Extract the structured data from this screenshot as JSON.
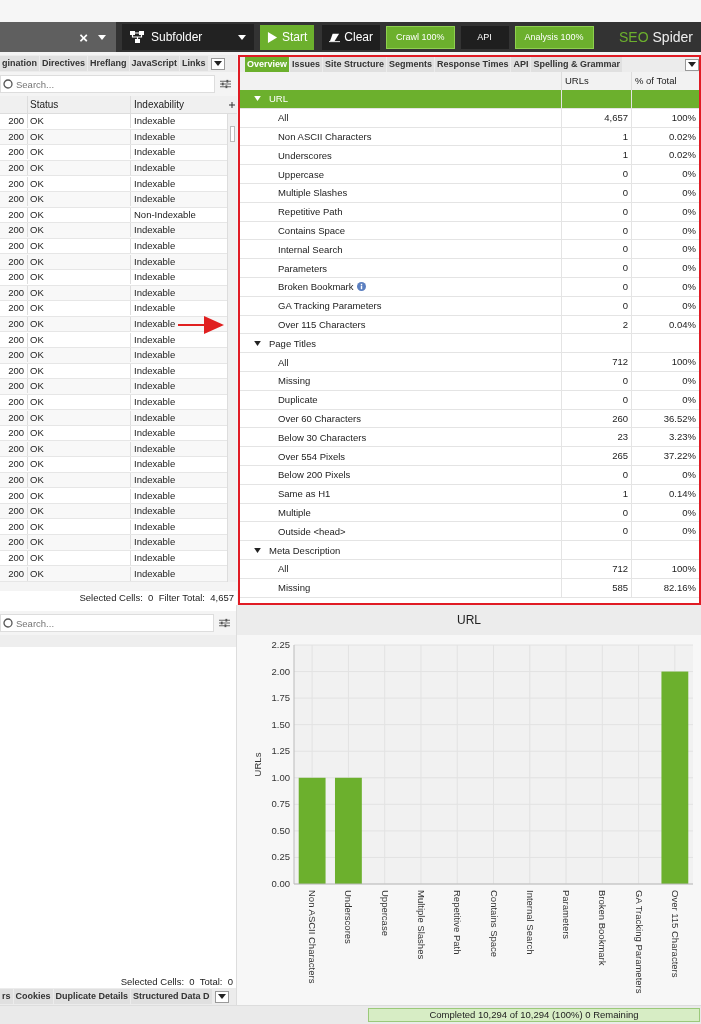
{
  "toolbar": {
    "url_field": {
      "clear_glyph": "×"
    },
    "mode": "Subfolder",
    "buttons": [
      {
        "label": "Start",
        "kind": "start"
      },
      {
        "label": "Clear",
        "kind": "clear"
      }
    ],
    "badges": [
      {
        "label": "Crawl 100%",
        "on": true
      },
      {
        "label": "API",
        "on": false
      },
      {
        "label": "Analysis 100%",
        "on": true
      }
    ],
    "logo": {
      "brand": "SEO",
      "product": "Spider"
    }
  },
  "left_tabs": [
    {
      "label": "gination",
      "selected": false
    },
    {
      "label": "Directives",
      "selected": false
    },
    {
      "label": "Hreflang",
      "selected": false
    },
    {
      "label": "JavaScript",
      "selected": false
    },
    {
      "label": "Links",
      "selected": false
    }
  ],
  "left_search": {
    "placeholder": "Search..."
  },
  "left_table": {
    "columns": [
      "Status",
      "Indexability"
    ],
    "rows": [
      {
        "code": "200",
        "status": "OK",
        "indexability": "Indexable"
      },
      {
        "code": "200",
        "status": "OK",
        "indexability": "Indexable"
      },
      {
        "code": "200",
        "status": "OK",
        "indexability": "Indexable"
      },
      {
        "code": "200",
        "status": "OK",
        "indexability": "Indexable"
      },
      {
        "code": "200",
        "status": "OK",
        "indexability": "Indexable"
      },
      {
        "code": "200",
        "status": "OK",
        "indexability": "Indexable"
      },
      {
        "code": "200",
        "status": "OK",
        "indexability": "Non-Indexable"
      },
      {
        "code": "200",
        "status": "OK",
        "indexability": "Indexable"
      },
      {
        "code": "200",
        "status": "OK",
        "indexability": "Indexable"
      },
      {
        "code": "200",
        "status": "OK",
        "indexability": "Indexable"
      },
      {
        "code": "200",
        "status": "OK",
        "indexability": "Indexable"
      },
      {
        "code": "200",
        "status": "OK",
        "indexability": "Indexable"
      },
      {
        "code": "200",
        "status": "OK",
        "indexability": "Indexable"
      },
      {
        "code": "200",
        "status": "OK",
        "indexability": "Indexable"
      },
      {
        "code": "200",
        "status": "OK",
        "indexability": "Indexable"
      },
      {
        "code": "200",
        "status": "OK",
        "indexability": "Indexable"
      },
      {
        "code": "200",
        "status": "OK",
        "indexability": "Indexable"
      },
      {
        "code": "200",
        "status": "OK",
        "indexability": "Indexable"
      },
      {
        "code": "200",
        "status": "OK",
        "indexability": "Indexable"
      },
      {
        "code": "200",
        "status": "OK",
        "indexability": "Indexable"
      },
      {
        "code": "200",
        "status": "OK",
        "indexability": "Indexable"
      },
      {
        "code": "200",
        "status": "OK",
        "indexability": "Indexable"
      },
      {
        "code": "200",
        "status": "OK",
        "indexability": "Indexable"
      },
      {
        "code": "200",
        "status": "OK",
        "indexability": "Indexable"
      },
      {
        "code": "200",
        "status": "OK",
        "indexability": "Indexable"
      },
      {
        "code": "200",
        "status": "OK",
        "indexability": "Indexable"
      },
      {
        "code": "200",
        "status": "OK",
        "indexability": "Indexable"
      },
      {
        "code": "200",
        "status": "OK",
        "indexability": "Indexable"
      },
      {
        "code": "200",
        "status": "OK",
        "indexability": "Indexable"
      },
      {
        "code": "200",
        "status": "OK",
        "indexability": "Indexable"
      }
    ],
    "footer": "Selected Cells:  0  Filter Total:  4,657"
  },
  "right_tabs": [
    {
      "label": "Overview",
      "selected": true
    },
    {
      "label": "Issues",
      "selected": false
    },
    {
      "label": "Site Structure",
      "selected": false
    },
    {
      "label": "Segments",
      "selected": false
    },
    {
      "label": "Response Times",
      "selected": false
    },
    {
      "label": "API",
      "selected": false
    },
    {
      "label": "Spelling & Grammar",
      "selected": false
    }
  ],
  "overview": {
    "highlighted": true,
    "columns": [
      "URLs",
      "% of Total"
    ],
    "groups": [
      {
        "name": "URL",
        "expanded": true,
        "selected": true,
        "rows": [
          {
            "label": "All",
            "urls": "4,657",
            "percent": "100%",
            "info": false
          },
          {
            "label": "Non ASCII Characters",
            "urls": "1",
            "percent": "0.02%",
            "info": false
          },
          {
            "label": "Underscores",
            "urls": "1",
            "percent": "0.02%",
            "info": false
          },
          {
            "label": "Uppercase",
            "urls": "0",
            "percent": "0%",
            "info": false
          },
          {
            "label": "Multiple Slashes",
            "urls": "0",
            "percent": "0%",
            "info": false
          },
          {
            "label": "Repetitive Path",
            "urls": "0",
            "percent": "0%",
            "info": false
          },
          {
            "label": "Contains Space",
            "urls": "0",
            "percent": "0%",
            "info": false
          },
          {
            "label": "Internal Search",
            "urls": "0",
            "percent": "0%",
            "info": false
          },
          {
            "label": "Parameters",
            "urls": "0",
            "percent": "0%",
            "info": false
          },
          {
            "label": "Broken Bookmark",
            "urls": "0",
            "percent": "0%",
            "info": true
          },
          {
            "label": "GA Tracking Parameters",
            "urls": "0",
            "percent": "0%",
            "info": false
          },
          {
            "label": "Over 115 Characters",
            "urls": "2",
            "percent": "0.04%",
            "info": false
          }
        ]
      },
      {
        "name": "Page Titles",
        "expanded": true,
        "selected": false,
        "rows": [
          {
            "label": "All",
            "urls": "712",
            "percent": "100%",
            "info": false
          },
          {
            "label": "Missing",
            "urls": "0",
            "percent": "0%",
            "info": false
          },
          {
            "label": "Duplicate",
            "urls": "0",
            "percent": "0%",
            "info": false
          },
          {
            "label": "Over 60 Characters",
            "urls": "260",
            "percent": "36.52%",
            "info": false
          },
          {
            "label": "Below 30 Characters",
            "urls": "23",
            "percent": "3.23%",
            "info": false
          },
          {
            "label": "Over 554 Pixels",
            "urls": "265",
            "percent": "37.22%",
            "info": false
          },
          {
            "label": "Below 200 Pixels",
            "urls": "0",
            "percent": "0%",
            "info": false
          },
          {
            "label": "Same as H1",
            "urls": "1",
            "percent": "0.14%",
            "info": false
          },
          {
            "label": "Multiple",
            "urls": "0",
            "percent": "0%",
            "info": false
          },
          {
            "label": "Outside <head>",
            "urls": "0",
            "percent": "0%",
            "info": false
          }
        ]
      },
      {
        "name": "Meta Description",
        "expanded": true,
        "selected": false,
        "rows": [
          {
            "label": "All",
            "urls": "712",
            "percent": "100%",
            "info": false
          },
          {
            "label": "Missing",
            "urls": "585",
            "percent": "82.16%",
            "info": false
          }
        ]
      }
    ]
  },
  "lower_left": {
    "search": {
      "placeholder": "Search..."
    },
    "footer": "Selected Cells:  0  Total:  0",
    "tabs": [
      {
        "label": "rs",
        "selected": false
      },
      {
        "label": "Cookies",
        "selected": false
      },
      {
        "label": "Duplicate Details",
        "selected": false
      },
      {
        "label": "Structured Data D",
        "selected": false
      }
    ]
  },
  "chart": {
    "chart_data": {
      "type": "bar",
      "title": "URL",
      "ylabel": "URLs",
      "categories": [
        "Non ASCII Characters",
        "Underscores",
        "Uppercase",
        "Multiple Slashes",
        "Repetitive Path",
        "Contains Space",
        "Internal Search",
        "Parameters",
        "Broken Bookmark",
        "GA Tracking Parameters",
        "Over 115 Characters"
      ],
      "grid": true,
      "series": [
        {
          "color": "#6cb02d",
          "values": [
            1,
            1,
            0,
            0,
            0,
            0,
            0,
            0,
            0,
            0,
            2
          ]
        }
      ],
      "ylim": [
        0,
        2.25
      ],
      "yticks": [
        {
          "value": 0,
          "label": "0.00"
        },
        {
          "value": 0.25,
          "label": "0.25"
        },
        {
          "value": 0.5,
          "label": "0.50"
        },
        {
          "value": 0.75,
          "label": "0.75"
        },
        {
          "value": 1,
          "label": "1.00"
        },
        {
          "value": 1.25,
          "label": "1.25"
        },
        {
          "value": 1.5,
          "label": "1.50"
        },
        {
          "value": 1.75,
          "label": "1.75"
        },
        {
          "value": 2,
          "label": "2.00"
        },
        {
          "value": 2.25,
          "label": "2.25"
        }
      ]
    }
  },
  "status_bar": {
    "text": "Completed 10,294 of 10,294 (100%) 0 Remaining",
    "level": 1
  }
}
